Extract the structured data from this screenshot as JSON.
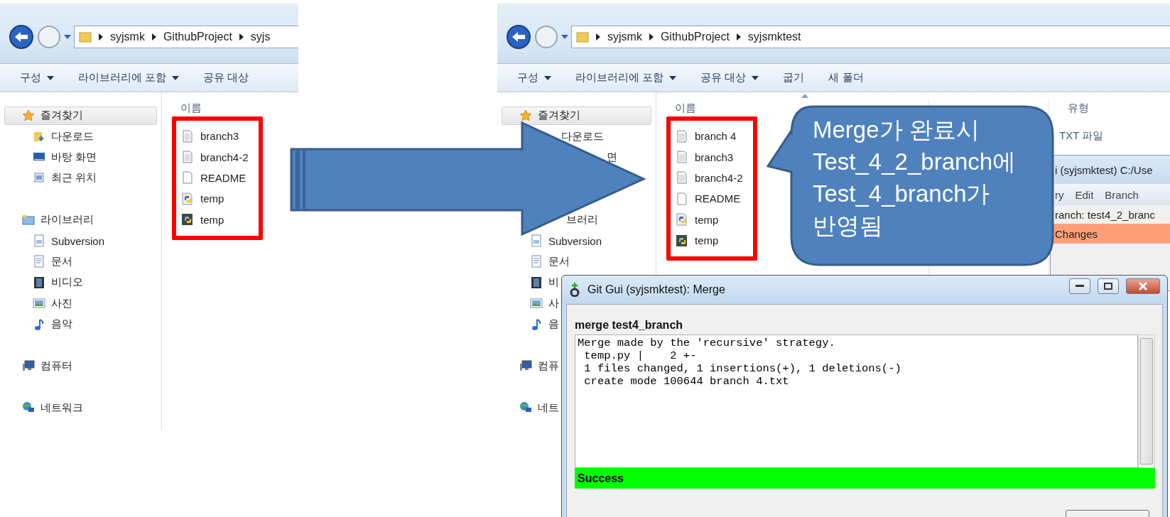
{
  "explorers": [
    {
      "address": [
        "syjsmk",
        "GithubProject",
        "syjs"
      ],
      "toolbar": [
        {
          "label": "구성",
          "dropdown": true
        },
        {
          "label": "라이브러리에 포함",
          "dropdown": true
        },
        {
          "label": "공유 대상",
          "dropdown": false
        }
      ],
      "sidebar": [
        {
          "label": "즐겨찾기",
          "kind": "star",
          "selected": true,
          "children": [
            {
              "label": "다운로드",
              "kind": "download"
            },
            {
              "label": "바탕 화면",
              "kind": "desktop"
            },
            {
              "label": "최근 위치",
              "kind": "recent"
            }
          ]
        },
        {
          "label": "라이브러리",
          "kind": "library",
          "selected": false,
          "children": [
            {
              "label": "Subversion",
              "kind": "svn"
            },
            {
              "label": "문서",
              "kind": "document"
            },
            {
              "label": "비디오",
              "kind": "video"
            },
            {
              "label": "사진",
              "kind": "picture"
            },
            {
              "label": "음악",
              "kind": "music"
            }
          ]
        },
        {
          "label": "컴퓨터",
          "kind": "computer",
          "selected": false
        },
        {
          "label": "네트워크",
          "kind": "network",
          "selected": false
        }
      ],
      "name_column": {
        "label": "이름"
      },
      "files": [
        {
          "name": "branch3",
          "kind": "text"
        },
        {
          "name": "branch4-2",
          "kind": "text"
        },
        {
          "name": "README",
          "kind": "blank"
        },
        {
          "name": "temp",
          "kind": "python"
        },
        {
          "name": "temp",
          "kind": "python-compiled"
        }
      ]
    },
    {
      "address": [
        "syjsmk",
        "GithubProject",
        "syjsmktest"
      ],
      "toolbar": [
        {
          "label": "구성",
          "dropdown": true
        },
        {
          "label": "라이브러리에 포함",
          "dropdown": true
        },
        {
          "label": "공유 대상",
          "dropdown": true
        },
        {
          "label": "굽기",
          "dropdown": false
        },
        {
          "label": "새 폴더",
          "dropdown": false
        }
      ],
      "sidebar": [
        {
          "label": "즐겨찾기",
          "kind": "star",
          "selected": true,
          "children": [
            {
              "label": "다운로드"
            },
            {
              "label": "면"
            }
          ]
        },
        {
          "label": "브러리",
          "selected": false,
          "children": [
            {
              "label": "Subversion",
              "kind": "svn"
            },
            {
              "label": "문서",
              "kind": "document"
            },
            {
              "label": "비",
              "kind": "video"
            },
            {
              "label": "사",
              "kind": "picture"
            },
            {
              "label": "음",
              "kind": "music"
            }
          ]
        },
        {
          "label": "컴퓨",
          "kind": "computer",
          "selected": false
        },
        {
          "label": "네트",
          "kind": "network",
          "selected": false
        }
      ],
      "name_column": {
        "label": "이름",
        "sorted": true
      },
      "type_column": {
        "label": "유형",
        "cells": [
          "TXT 파일"
        ]
      },
      "files": [
        {
          "name": "branch 4",
          "kind": "text"
        },
        {
          "name": "branch3",
          "kind": "text"
        },
        {
          "name": "branch4-2",
          "kind": "text"
        },
        {
          "name": "README",
          "kind": "blank"
        },
        {
          "name": "temp",
          "kind": "python"
        },
        {
          "name": "temp",
          "kind": "python-compiled"
        }
      ]
    }
  ],
  "callout": {
    "lines": [
      "Merge가 완료시",
      "Test_4_2_branch에",
      "Test_4_branch가",
      "반영됨"
    ]
  },
  "git_gui_window": {
    "title": "i (syjsmktest) C:/Use",
    "menu": [
      "ry",
      "Edit",
      "Branch"
    ],
    "branch_line": "ranch: test4_2_branc",
    "changes_header": "Changes"
  },
  "merge_dialog": {
    "title": "Git Gui (syjsmktest): Merge",
    "heading": "merge test4_branch",
    "log": [
      "Merge made by the 'recursive' strategy.",
      " temp.py |    2 +-",
      " 1 files changed, 1 insertions(+), 1 deletions(-)",
      " create mode 100644 branch 4.txt"
    ],
    "status": "Success"
  }
}
